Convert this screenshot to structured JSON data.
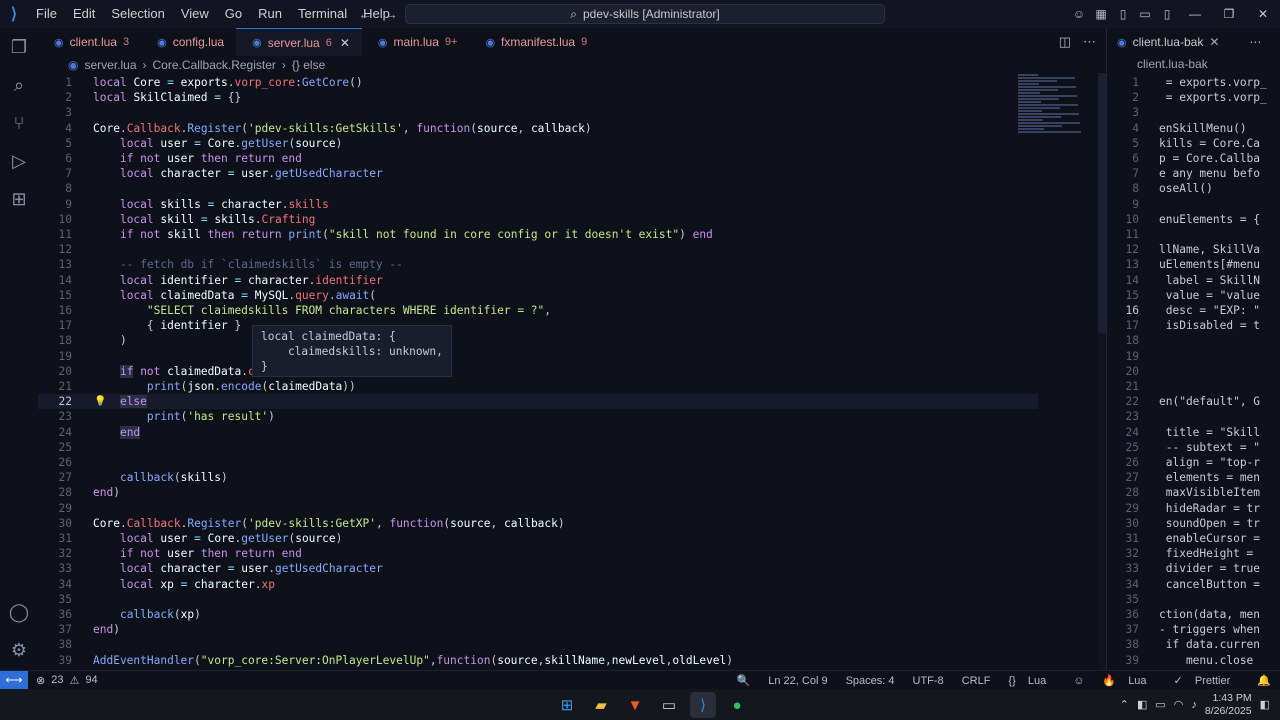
{
  "menu": [
    "File",
    "Edit",
    "Selection",
    "View",
    "Go",
    "Run",
    "Terminal",
    "Help"
  ],
  "command_center": "pdev-skills [Administrator]",
  "tabs": [
    {
      "name": "client.lua",
      "count": "3",
      "active": false
    },
    {
      "name": "config.lua",
      "count": "",
      "active": false
    },
    {
      "name": "server.lua",
      "count": "6",
      "active": true
    },
    {
      "name": "main.lua",
      "count": "9+",
      "active": false
    },
    {
      "name": "fxmanifest.lua",
      "count": "9",
      "active": false
    }
  ],
  "right_tab": "client.lua-bak",
  "breadcrumbs": [
    "server.lua",
    "Core.Callback.Register",
    "{} else"
  ],
  "right_breadcrumb": "client.lua-bak",
  "current_line": 22,
  "lines": [
    {
      "n": 1,
      "html": "<span class='kw'>local</span> <span class='var'>Core</span> <span class='op'>=</span> <span class='var'>exports</span>.<span class='prop'>vorp_core</span>:<span class='fn'>GetCore</span>()"
    },
    {
      "n": 2,
      "html": "<span class='kw'>local</span> <span class='var'>SkilClaimed</span> <span class='op'>=</span> {}"
    },
    {
      "n": 3,
      "html": ""
    },
    {
      "n": 4,
      "html": "<span class='var'>Core</span>.<span class='prop'>Callback</span>.<span class='fn'>Register</span>(<span class='str'>'pdev-skills:GetSkills'</span>, <span class='kw'>function</span>(<span class='var'>source</span>, <span class='var'>callback</span>)"
    },
    {
      "n": 5,
      "html": "    <span class='kw'>local</span> <span class='var'>user</span> <span class='op'>=</span> <span class='var'>Core</span>.<span class='fn'>getUser</span>(<span class='var'>source</span>)"
    },
    {
      "n": 6,
      "html": "    <span class='kw'>if not</span> <span class='var'>user</span> <span class='kw'>then return end</span>"
    },
    {
      "n": 7,
      "html": "    <span class='kw'>local</span> <span class='var'>character</span> <span class='op'>=</span> <span class='var'>user</span>.<span class='fn'>getUsedCharacter</span>"
    },
    {
      "n": 8,
      "html": ""
    },
    {
      "n": 9,
      "html": "    <span class='kw'>local</span> <span class='var'>skills</span> <span class='op'>=</span> <span class='var'>character</span>.<span class='prop'>skills</span>"
    },
    {
      "n": 10,
      "html": "    <span class='kw'>local</span> <span class='var'>skill</span> <span class='op'>=</span> <span class='var'>skills</span>.<span class='prop'>Crafting</span>"
    },
    {
      "n": 11,
      "html": "    <span class='kw'>if not</span> <span class='var'>skill</span> <span class='kw'>then return</span> <span class='fn'>print</span>(<span class='str'>\"skill not found in core config or it doesn't exist\"</span>) <span class='kw'>end</span>"
    },
    {
      "n": 12,
      "html": ""
    },
    {
      "n": 13,
      "html": "    <span class='cm'>-- fetch db if `claimedskills` is empty --</span>"
    },
    {
      "n": 14,
      "html": "    <span class='kw'>local</span> <span class='var'>identifier</span> <span class='op'>=</span> <span class='var'>character</span>.<span class='prop'>identifier</span>"
    },
    {
      "n": 15,
      "html": "    <span class='kw'>local</span> <span class='var'>claimedData</span> <span class='op'>=</span> <span class='var'>MySQL</span>.<span class='prop'>query</span>.<span class='fn'>await</span>("
    },
    {
      "n": 16,
      "html": "        <span class='str'>\"SELECT claimedskills FROM characters WHERE identifier = ?\"</span>,"
    },
    {
      "n": 17,
      "html": "        { <span class='var'>identifier</span> }"
    },
    {
      "n": 18,
      "html": "    )"
    },
    {
      "n": 19,
      "html": ""
    },
    {
      "n": 20,
      "html": "    <span class='kw hl'>if</span> <span class='kw'>not</span> <span class='var'>claimedData</span>.<span class='prop'>cla</span>"
    },
    {
      "n": 21,
      "html": "        <span class='fn'>print</span>(<span class='var'>json</span>.<span class='fn'>encode</span>(<span class='var'>claimedData</span>))"
    },
    {
      "n": 22,
      "html": "    <span class='kw hl'>else</span>"
    },
    {
      "n": 23,
      "html": "        <span class='fn'>print</span>(<span class='str'>'has result'</span>)"
    },
    {
      "n": 24,
      "html": "    <span class='kw hl'>end</span>"
    },
    {
      "n": 25,
      "html": ""
    },
    {
      "n": 26,
      "html": ""
    },
    {
      "n": 27,
      "html": "    <span class='fn'>callback</span>(<span class='var'>skills</span>)"
    },
    {
      "n": 28,
      "html": "<span class='kw'>end</span>)"
    },
    {
      "n": 29,
      "html": ""
    },
    {
      "n": 30,
      "html": "<span class='var'>Core</span>.<span class='prop'>Callback</span>.<span class='fn'>Register</span>(<span class='str'>'pdev-skills:GetXP'</span>, <span class='kw'>function</span>(<span class='var'>source</span>, <span class='var'>callback</span>)"
    },
    {
      "n": 31,
      "html": "    <span class='kw'>local</span> <span class='var'>user</span> <span class='op'>=</span> <span class='var'>Core</span>.<span class='fn'>getUser</span>(<span class='var'>source</span>)"
    },
    {
      "n": 32,
      "html": "    <span class='kw'>if not</span> <span class='var'>user</span> <span class='kw'>then return end</span>"
    },
    {
      "n": 33,
      "html": "    <span class='kw'>local</span> <span class='var'>character</span> <span class='op'>=</span> <span class='var'>user</span>.<span class='fn'>getUsedCharacter</span>"
    },
    {
      "n": 34,
      "html": "    <span class='kw'>local</span> <span class='var'>xp</span> <span class='op'>=</span> <span class='var'>character</span>.<span class='prop'>xp</span>"
    },
    {
      "n": 35,
      "html": ""
    },
    {
      "n": 36,
      "html": "    <span class='fn'>callback</span>(<span class='var'>xp</span>)"
    },
    {
      "n": 37,
      "html": "<span class='kw'>end</span>)"
    },
    {
      "n": 38,
      "html": ""
    },
    {
      "n": 39,
      "html": "<span class='fn'>AddEventHandler</span>(<span class='str'>\"vorp_core:Server:OnPlayerLevelUp\"</span>,<span class='kw'>function</span>(<span class='var'>source</span>,<span class='var'>skillName</span>,<span class='var'>newLevel</span>,<span class='var'>oldLevel</span>)"
    }
  ],
  "hover": "local claimedData: {\n    claimedskills: unknown,\n}",
  "right_lines": [
    {
      "n": 1,
      "t": " = exports.vorp_"
    },
    {
      "n": 2,
      "t": " = exports.vorp_"
    },
    {
      "n": 3,
      "t": ""
    },
    {
      "n": 4,
      "t": "enSkillMenu()"
    },
    {
      "n": 5,
      "t": "kills = Core.Ca"
    },
    {
      "n": 6,
      "t": "p = Core.Callba"
    },
    {
      "n": 7,
      "t": "e any menu befo"
    },
    {
      "n": 8,
      "t": "oseAll()"
    },
    {
      "n": 9,
      "t": ""
    },
    {
      "n": 10,
      "t": "enuElements = {"
    },
    {
      "n": 11,
      "t": ""
    },
    {
      "n": 12,
      "t": "llName, SkillVa"
    },
    {
      "n": 13,
      "t": "uElements[#menu"
    },
    {
      "n": 14,
      "t": " label = SkillN"
    },
    {
      "n": 15,
      "t": " value = \"value"
    },
    {
      "n": 16,
      "t": " desc = \"EXP: \""
    },
    {
      "n": 17,
      "t": " isDisabled = t"
    },
    {
      "n": 18,
      "t": ""
    },
    {
      "n": 19,
      "t": ""
    },
    {
      "n": 20,
      "t": ""
    },
    {
      "n": 21,
      "t": ""
    },
    {
      "n": 22,
      "t": "en(\"default\", G"
    },
    {
      "n": 23,
      "t": ""
    },
    {
      "n": 24,
      "t": " title = \"Skill"
    },
    {
      "n": 25,
      "t": " -- subtext = \""
    },
    {
      "n": 26,
      "t": " align = \"top-r"
    },
    {
      "n": 27,
      "t": " elements = men"
    },
    {
      "n": 28,
      "t": " maxVisibleItem"
    },
    {
      "n": 29,
      "t": " hideRadar = tr"
    },
    {
      "n": 30,
      "t": " soundOpen = tr"
    },
    {
      "n": 31,
      "t": " enableCursor ="
    },
    {
      "n": 32,
      "t": " fixedHeight ="
    },
    {
      "n": 33,
      "t": " divider = true"
    },
    {
      "n": 34,
      "t": " cancelButton ="
    },
    {
      "n": 35,
      "t": ""
    },
    {
      "n": 36,
      "t": "ction(data, men"
    },
    {
      "n": 37,
      "t": "- triggers when"
    },
    {
      "n": 38,
      "t": " if data.curren"
    },
    {
      "n": 39,
      "t": "    menu.close"
    }
  ],
  "status": {
    "errors": "23",
    "warnings": "94",
    "position": "Ln 22, Col 9",
    "spaces": "Spaces: 4",
    "encoding": "UTF-8",
    "eol": "CRLF",
    "language": "Lua",
    "lua_ext": "Lua",
    "prettier": "Prettier"
  },
  "clock": {
    "time": "1:43 PM",
    "date": "8/26/2025"
  }
}
